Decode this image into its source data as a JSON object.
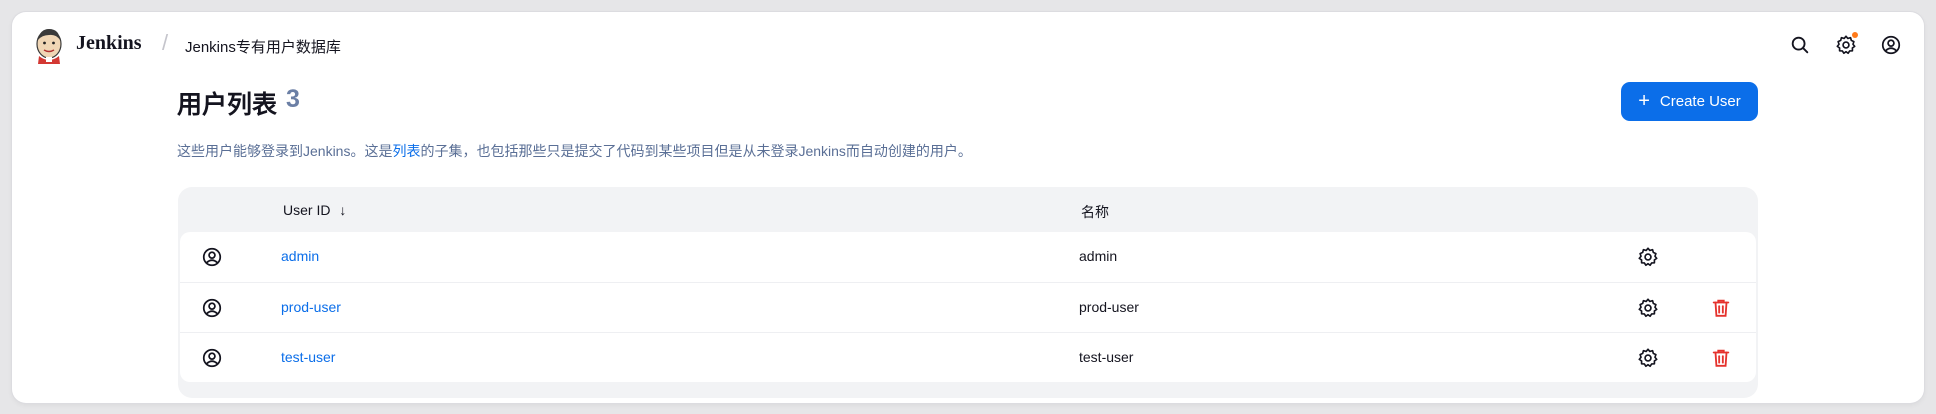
{
  "header": {
    "brand": "Jenkins",
    "breadcrumb_separator": "/",
    "breadcrumb": "Jenkins专有用户数据库",
    "icons": [
      "search-icon",
      "gear-icon",
      "user-icon"
    ],
    "notification_color": "#ff7a1a"
  },
  "page": {
    "title": "用户列表",
    "count": "3",
    "create_button": "Create User",
    "create_button_icon": "plus-icon",
    "desc_before": "这些用户能够登录到Jenkins。这是",
    "desc_link": "列表",
    "desc_after": "的子集，也包括那些只是提交了代码到某些项目但是从未登录Jenkins而自动创建的用户。"
  },
  "table": {
    "columns": {
      "user_id": "User ID",
      "sort_icon": "↓",
      "name": "名称"
    },
    "rows": [
      {
        "user_id": "admin",
        "name": "admin",
        "deletable": false
      },
      {
        "user_id": "prod-user",
        "name": "prod-user",
        "deletable": true
      },
      {
        "user_id": "test-user",
        "name": "test-user",
        "deletable": true
      }
    ]
  },
  "colors": {
    "accent": "#0b6ee9",
    "delete": "#e5322d",
    "count": "#6b7fa5"
  }
}
